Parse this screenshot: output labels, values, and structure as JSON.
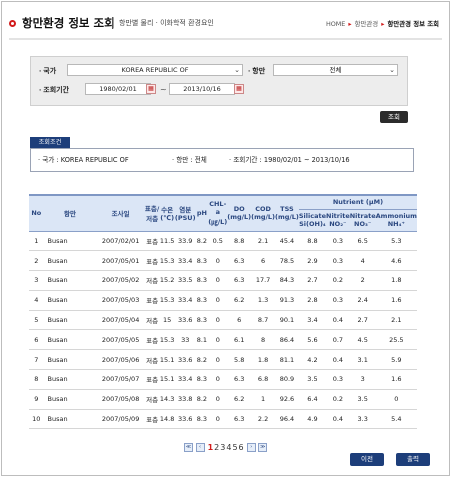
{
  "header": {
    "title": "항만환경 정보 조회",
    "subtitle": "항만별 물리 · 이화학적 환경요인",
    "breadcrumb": [
      "HOME",
      "항만관경",
      "항만관경 정보 조회"
    ]
  },
  "search": {
    "country_label": "국가",
    "country_value": "KOREA REPUBLIC OF",
    "port_label": "항만",
    "port_value": "전체",
    "period_label": "조회기간",
    "date_from": "1980/02/01",
    "date_to": "2013/10/16",
    "dash": "~",
    "search_button": "조회"
  },
  "conditions": {
    "tab_label": "조회조건",
    "country": "· 국가 :  KOREA REPUBLIC OF",
    "port": "· 항만 :  전체",
    "period": "· 조회기간 :  1980/02/01 ~ 2013/10/16"
  },
  "table": {
    "headers": {
      "no": "No",
      "port": "항만",
      "date": "조사일",
      "layer": "표층/저층",
      "temp": "수온 (℃)",
      "salinity": "염분 (PSU)",
      "ph": "pH",
      "chl": "CHL-a (㎍/L)",
      "do": "DO (mg/L)",
      "cod": "COD (mg/L)",
      "tss": "TSS (mg/L)",
      "nutrient": "Nutrient (μM)",
      "silicate": "Silicate Si(OH)₄",
      "nitrite": "Nitrite NO₂⁻",
      "nitrate": "Nitrate NO₃⁻",
      "ammonium": "Ammonium NH₄⁺"
    },
    "rows": [
      [
        "1",
        "Busan",
        "2007/02/01",
        "표층",
        "11.5",
        "33.9",
        "8.2",
        "0.5",
        "8.8",
        "2.1",
        "45.4",
        "8.8",
        "0.3",
        "6.5",
        "5.3"
      ],
      [
        "2",
        "Busan",
        "2007/05/01",
        "표층",
        "15.3",
        "33.4",
        "8.3",
        "0",
        "6.3",
        "6",
        "78.5",
        "2.9",
        "0.3",
        "4",
        "4.6"
      ],
      [
        "3",
        "Busan",
        "2007/05/02",
        "저층",
        "15.2",
        "33.5",
        "8.3",
        "0",
        "6.3",
        "17.7",
        "84.3",
        "2.7",
        "0.2",
        "2",
        "1.8"
      ],
      [
        "4",
        "Busan",
        "2007/05/03",
        "표층",
        "15.3",
        "33.4",
        "8.3",
        "0",
        "6.2",
        "1.3",
        "91.3",
        "2.8",
        "0.3",
        "2.4",
        "1.6"
      ],
      [
        "5",
        "Busan",
        "2007/05/04",
        "저층",
        "15",
        "33.6",
        "8.3",
        "0",
        "6",
        "8.7",
        "90.1",
        "3.4",
        "0.4",
        "2.7",
        "2.1"
      ],
      [
        "6",
        "Busan",
        "2007/05/05",
        "표층",
        "15.3",
        "33",
        "8.1",
        "0",
        "6.1",
        "8",
        "86.4",
        "5.6",
        "0.7",
        "4.5",
        "25.5"
      ],
      [
        "7",
        "Busan",
        "2007/05/06",
        "저층",
        "15.1",
        "33.6",
        "8.2",
        "0",
        "5.8",
        "1.8",
        "81.1",
        "4.2",
        "0.4",
        "3.1",
        "5.9"
      ],
      [
        "8",
        "Busan",
        "2007/05/07",
        "표층",
        "15.1",
        "33.4",
        "8.3",
        "0",
        "6.3",
        "6.8",
        "80.9",
        "3.5",
        "0.3",
        "3",
        "1.6"
      ],
      [
        "9",
        "Busan",
        "2007/05/08",
        "저층",
        "14.3",
        "33.8",
        "8.2",
        "0",
        "6.2",
        "1",
        "92.6",
        "6.4",
        "0.2",
        "3.5",
        "0"
      ],
      [
        "10",
        "Busan",
        "2007/05/09",
        "표층",
        "14.8",
        "33.6",
        "8.3",
        "0",
        "6.3",
        "2.2",
        "96.4",
        "4.9",
        "0.4",
        "3.3",
        "5.4"
      ]
    ]
  },
  "pagination": {
    "first": "≪",
    "prev": "‹",
    "pages": [
      "1",
      "2",
      "3",
      "4",
      "5",
      "6"
    ],
    "current": "1",
    "next": "›",
    "last": "≫"
  },
  "buttons": {
    "prev": "이전",
    "print": "출력"
  }
}
